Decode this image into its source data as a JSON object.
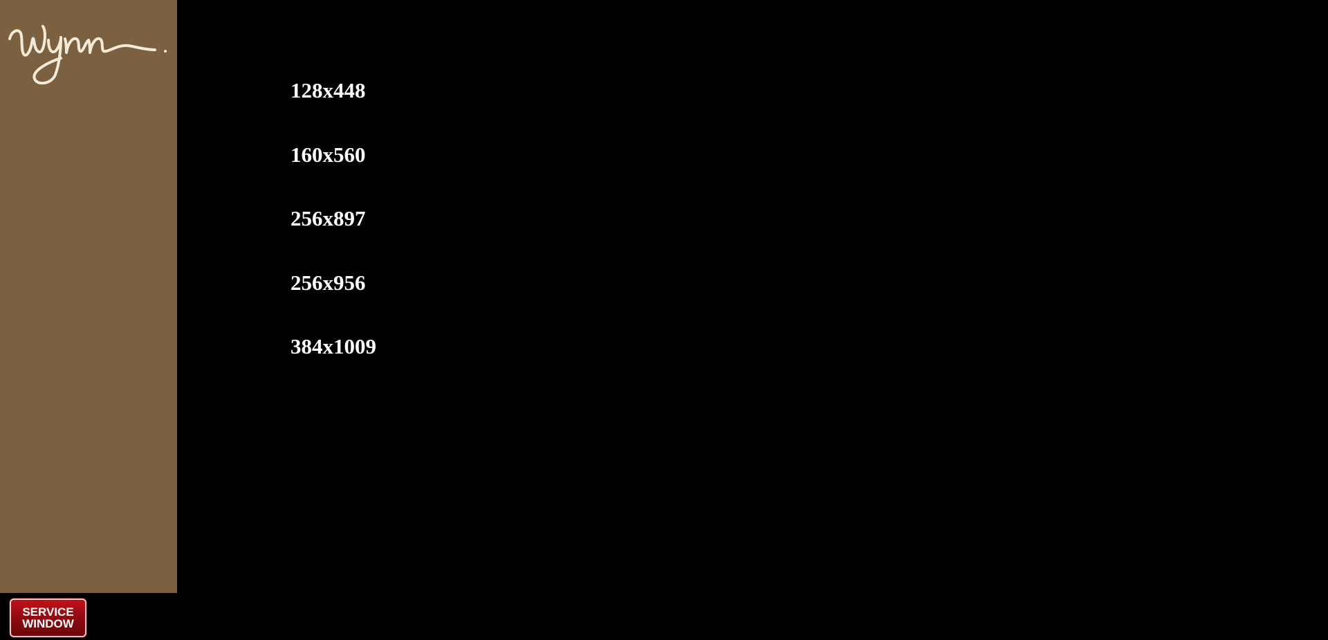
{
  "brand": {
    "logo_text": "Wynn.",
    "sidebar_color": "#7c6141",
    "logo_color": "#f3ead8"
  },
  "resolutions": [
    {
      "label": "128x448"
    },
    {
      "label": "160x560"
    },
    {
      "label": "256x897"
    },
    {
      "label": "256x956"
    },
    {
      "label": "384x1009"
    }
  ],
  "service_window_button": {
    "line1": "SERVICE",
    "line2": "WINDOW",
    "color": "#a10e15"
  }
}
